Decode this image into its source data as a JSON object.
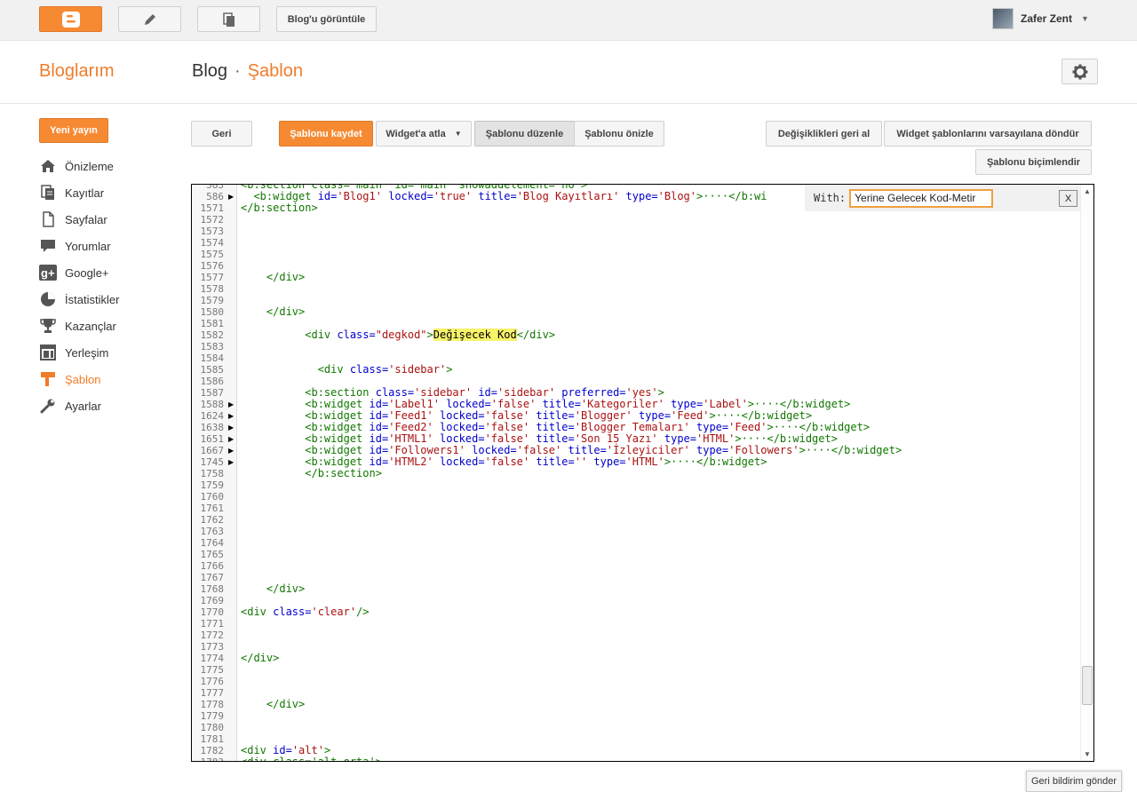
{
  "topbar": {
    "view_blog": "Blog'u görüntüle",
    "user_name": "Zafer Zent"
  },
  "header": {
    "my_blogs": "Bloglarım",
    "crumb_blog": "Blog",
    "crumb_sep": "·",
    "crumb_current": "Şablon"
  },
  "sidebar": {
    "new_post": "Yeni yayın",
    "items": [
      {
        "label": "Önizleme",
        "icon": "home-icon"
      },
      {
        "label": "Kayıtlar",
        "icon": "posts-icon"
      },
      {
        "label": "Sayfalar",
        "icon": "pages-icon"
      },
      {
        "label": "Yorumlar",
        "icon": "comments-icon"
      },
      {
        "label": "Google+",
        "icon": "google-plus-icon"
      },
      {
        "label": "İstatistikler",
        "icon": "stats-icon"
      },
      {
        "label": "Kazançlar",
        "icon": "trophy-icon"
      },
      {
        "label": "Yerleşim",
        "icon": "layout-icon"
      },
      {
        "label": "Şablon",
        "icon": "template-icon"
      },
      {
        "label": "Ayarlar",
        "icon": "wrench-icon"
      }
    ],
    "active_index": 8
  },
  "toolbar": {
    "back": "Geri",
    "save_template": "Şablonu kaydet",
    "jump_widget": "Widget'a atla",
    "edit_template": "Şablonu düzenle",
    "preview_template": "Şablonu önizle",
    "revert_changes": "Değişiklikleri geri al",
    "revert_widgets": "Widget şablonlarını varsayılana döndür",
    "format_template": "Şablonu biçimlendir"
  },
  "findbar": {
    "label": "With:",
    "value": "Yerine Gelecek Kod-Metir",
    "close": "X"
  },
  "editor": {
    "lines": [
      {
        "n": "583",
        "fold": false,
        "parts": [
          [
            "tag",
            "<b:section class='main' id='main' showaddelement='no'>"
          ]
        ]
      },
      {
        "n": "586",
        "fold": true,
        "parts": [
          [
            "tag",
            "  <b:widget "
          ],
          [
            "attr",
            "id="
          ],
          [
            "val",
            "'Blog1'"
          ],
          [
            "attr",
            " locked="
          ],
          [
            "val",
            "'true'"
          ],
          [
            "attr",
            " title="
          ],
          [
            "val",
            "'Blog Kayıtları'"
          ],
          [
            "attr",
            " type="
          ],
          [
            "val",
            "'Blog'"
          ],
          [
            "tag",
            ">····</b:wi"
          ]
        ]
      },
      {
        "n": "1571",
        "fold": false,
        "parts": [
          [
            "tag",
            "</b:section>"
          ]
        ]
      },
      {
        "n": "1572",
        "fold": false,
        "parts": []
      },
      {
        "n": "1573",
        "fold": false,
        "parts": []
      },
      {
        "n": "1574",
        "fold": false,
        "parts": []
      },
      {
        "n": "1575",
        "fold": false,
        "parts": []
      },
      {
        "n": "1576",
        "fold": false,
        "parts": []
      },
      {
        "n": "1577",
        "fold": false,
        "parts": [
          [
            "tag",
            "    </div>"
          ]
        ]
      },
      {
        "n": "1578",
        "fold": false,
        "parts": []
      },
      {
        "n": "1579",
        "fold": false,
        "parts": []
      },
      {
        "n": "1580",
        "fold": false,
        "parts": [
          [
            "tag",
            "    </div>"
          ]
        ]
      },
      {
        "n": "1581",
        "fold": false,
        "parts": []
      },
      {
        "n": "1582",
        "fold": false,
        "parts": [
          [
            "tag",
            "          <div "
          ],
          [
            "attr",
            "class="
          ],
          [
            "val",
            "\"degkod\""
          ],
          [
            "tag",
            ">"
          ],
          [
            "hl",
            "Değişecek Kod"
          ],
          [
            "tag",
            "</div>"
          ]
        ]
      },
      {
        "n": "1583",
        "fold": false,
        "parts": []
      },
      {
        "n": "1584",
        "fold": false,
        "parts": []
      },
      {
        "n": "1585",
        "fold": false,
        "parts": [
          [
            "tag",
            "            <div "
          ],
          [
            "attr",
            "class="
          ],
          [
            "val",
            "'sidebar'"
          ],
          [
            "tag",
            ">"
          ]
        ]
      },
      {
        "n": "1586",
        "fold": false,
        "parts": []
      },
      {
        "n": "1587",
        "fold": false,
        "parts": [
          [
            "tag",
            "          <b:section "
          ],
          [
            "attr",
            "class="
          ],
          [
            "val",
            "'sidebar'"
          ],
          [
            "attr",
            " id="
          ],
          [
            "val",
            "'sidebar'"
          ],
          [
            "attr",
            " preferred="
          ],
          [
            "val",
            "'yes'"
          ],
          [
            "tag",
            ">"
          ]
        ]
      },
      {
        "n": "1588",
        "fold": true,
        "parts": [
          [
            "tag",
            "          <b:widget "
          ],
          [
            "attr",
            "id="
          ],
          [
            "val",
            "'Label1'"
          ],
          [
            "attr",
            " locked="
          ],
          [
            "val",
            "'false'"
          ],
          [
            "attr",
            " title="
          ],
          [
            "val",
            "'Kategoriler'"
          ],
          [
            "attr",
            " type="
          ],
          [
            "val",
            "'Label'"
          ],
          [
            "tag",
            ">····</b:widget>"
          ]
        ]
      },
      {
        "n": "1624",
        "fold": true,
        "parts": [
          [
            "tag",
            "          <b:widget "
          ],
          [
            "attr",
            "id="
          ],
          [
            "val",
            "'Feed1'"
          ],
          [
            "attr",
            " locked="
          ],
          [
            "val",
            "'false'"
          ],
          [
            "attr",
            " title="
          ],
          [
            "val",
            "'Blogger'"
          ],
          [
            "attr",
            " type="
          ],
          [
            "val",
            "'Feed'"
          ],
          [
            "tag",
            ">····</b:widget>"
          ]
        ]
      },
      {
        "n": "1638",
        "fold": true,
        "parts": [
          [
            "tag",
            "          <b:widget "
          ],
          [
            "attr",
            "id="
          ],
          [
            "val",
            "'Feed2'"
          ],
          [
            "attr",
            " locked="
          ],
          [
            "val",
            "'false'"
          ],
          [
            "attr",
            " title="
          ],
          [
            "val",
            "'Blogger Temaları'"
          ],
          [
            "attr",
            " type="
          ],
          [
            "val",
            "'Feed'"
          ],
          [
            "tag",
            ">····</b:widget>"
          ]
        ]
      },
      {
        "n": "1651",
        "fold": true,
        "parts": [
          [
            "tag",
            "          <b:widget "
          ],
          [
            "attr",
            "id="
          ],
          [
            "val",
            "'HTML1'"
          ],
          [
            "attr",
            " locked="
          ],
          [
            "val",
            "'false'"
          ],
          [
            "attr",
            " title="
          ],
          [
            "val",
            "'Son 15 Yazı'"
          ],
          [
            "attr",
            " type="
          ],
          [
            "val",
            "'HTML'"
          ],
          [
            "tag",
            ">····</b:widget>"
          ]
        ]
      },
      {
        "n": "1667",
        "fold": true,
        "parts": [
          [
            "tag",
            "          <b:widget "
          ],
          [
            "attr",
            "id="
          ],
          [
            "val",
            "'Followers1'"
          ],
          [
            "attr",
            " locked="
          ],
          [
            "val",
            "'false'"
          ],
          [
            "attr",
            " title="
          ],
          [
            "val",
            "'İzleyiciler'"
          ],
          [
            "attr",
            " type="
          ],
          [
            "val",
            "'Followers'"
          ],
          [
            "tag",
            ">····</b:widget>"
          ]
        ]
      },
      {
        "n": "1745",
        "fold": true,
        "parts": [
          [
            "tag",
            "          <b:widget "
          ],
          [
            "attr",
            "id="
          ],
          [
            "val",
            "'HTML2'"
          ],
          [
            "attr",
            " locked="
          ],
          [
            "val",
            "'false'"
          ],
          [
            "attr",
            " title="
          ],
          [
            "val",
            "''"
          ],
          [
            "attr",
            " type="
          ],
          [
            "val",
            "'HTML'"
          ],
          [
            "tag",
            ">····</b:widget>"
          ]
        ]
      },
      {
        "n": "1758",
        "fold": false,
        "parts": [
          [
            "tag",
            "          </b:section>"
          ]
        ]
      },
      {
        "n": "1759",
        "fold": false,
        "parts": []
      },
      {
        "n": "1760",
        "fold": false,
        "parts": []
      },
      {
        "n": "1761",
        "fold": false,
        "parts": []
      },
      {
        "n": "1762",
        "fold": false,
        "parts": []
      },
      {
        "n": "1763",
        "fold": false,
        "parts": []
      },
      {
        "n": "1764",
        "fold": false,
        "parts": []
      },
      {
        "n": "1765",
        "fold": false,
        "parts": []
      },
      {
        "n": "1766",
        "fold": false,
        "parts": []
      },
      {
        "n": "1767",
        "fold": false,
        "parts": []
      },
      {
        "n": "1768",
        "fold": false,
        "parts": [
          [
            "tag",
            "    </div>"
          ]
        ]
      },
      {
        "n": "1769",
        "fold": false,
        "parts": []
      },
      {
        "n": "1770",
        "fold": false,
        "parts": [
          [
            "tag",
            "<div "
          ],
          [
            "attr",
            "class="
          ],
          [
            "val",
            "'clear'"
          ],
          [
            "tag",
            "/>"
          ]
        ]
      },
      {
        "n": "1771",
        "fold": false,
        "parts": []
      },
      {
        "n": "1772",
        "fold": false,
        "parts": []
      },
      {
        "n": "1773",
        "fold": false,
        "parts": []
      },
      {
        "n": "1774",
        "fold": false,
        "parts": [
          [
            "tag",
            "</div>"
          ]
        ]
      },
      {
        "n": "1775",
        "fold": false,
        "parts": []
      },
      {
        "n": "1776",
        "fold": false,
        "parts": []
      },
      {
        "n": "1777",
        "fold": false,
        "parts": []
      },
      {
        "n": "1778",
        "fold": false,
        "parts": [
          [
            "tag",
            "    </div>"
          ]
        ]
      },
      {
        "n": "1779",
        "fold": false,
        "parts": []
      },
      {
        "n": "1780",
        "fold": false,
        "parts": []
      },
      {
        "n": "1781",
        "fold": false,
        "parts": []
      },
      {
        "n": "1782",
        "fold": false,
        "parts": [
          [
            "tag",
            "<div "
          ],
          [
            "attr",
            "id="
          ],
          [
            "val",
            "'alt'"
          ],
          [
            "tag",
            ">"
          ]
        ]
      },
      {
        "n": "1783",
        "fold": false,
        "parts": [
          [
            "tag",
            "<div class='alt-orta'>"
          ]
        ]
      }
    ]
  },
  "feedback": "Geri bildirim gönder",
  "colors": {
    "accent": "#f07c2a",
    "button_orange": "#f68a33",
    "highlight": "#f7f36b"
  }
}
